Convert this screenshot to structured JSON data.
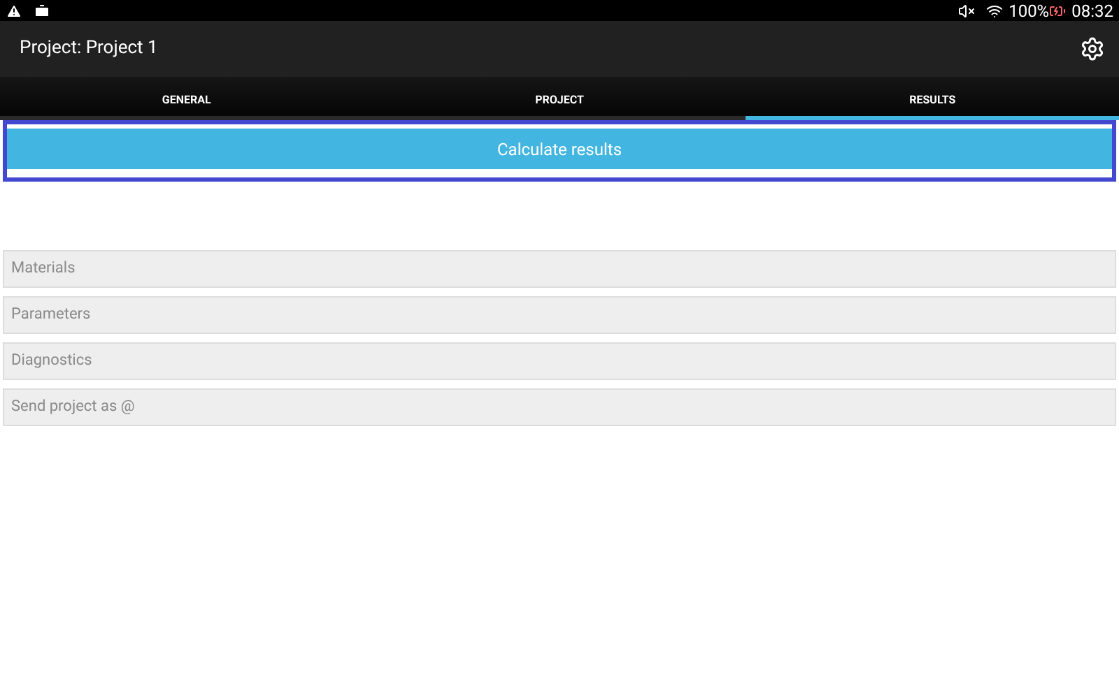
{
  "status_bar": {
    "battery": "100%",
    "time": "08:32"
  },
  "app_bar": {
    "title": "Project: Project 1"
  },
  "tabs": [
    {
      "label": "GENERAL",
      "selected": false
    },
    {
      "label": "PROJECT",
      "selected": false
    },
    {
      "label": "RESULTS",
      "selected": true
    }
  ],
  "action_button": {
    "label": "Calculate results",
    "focused": true
  },
  "sections": [
    {
      "label": "Materials",
      "disabled": true
    },
    {
      "label": "Parameters",
      "disabled": true
    },
    {
      "label": "Diagnostics",
      "disabled": true
    },
    {
      "label": "Send project as @",
      "disabled": true
    }
  ]
}
